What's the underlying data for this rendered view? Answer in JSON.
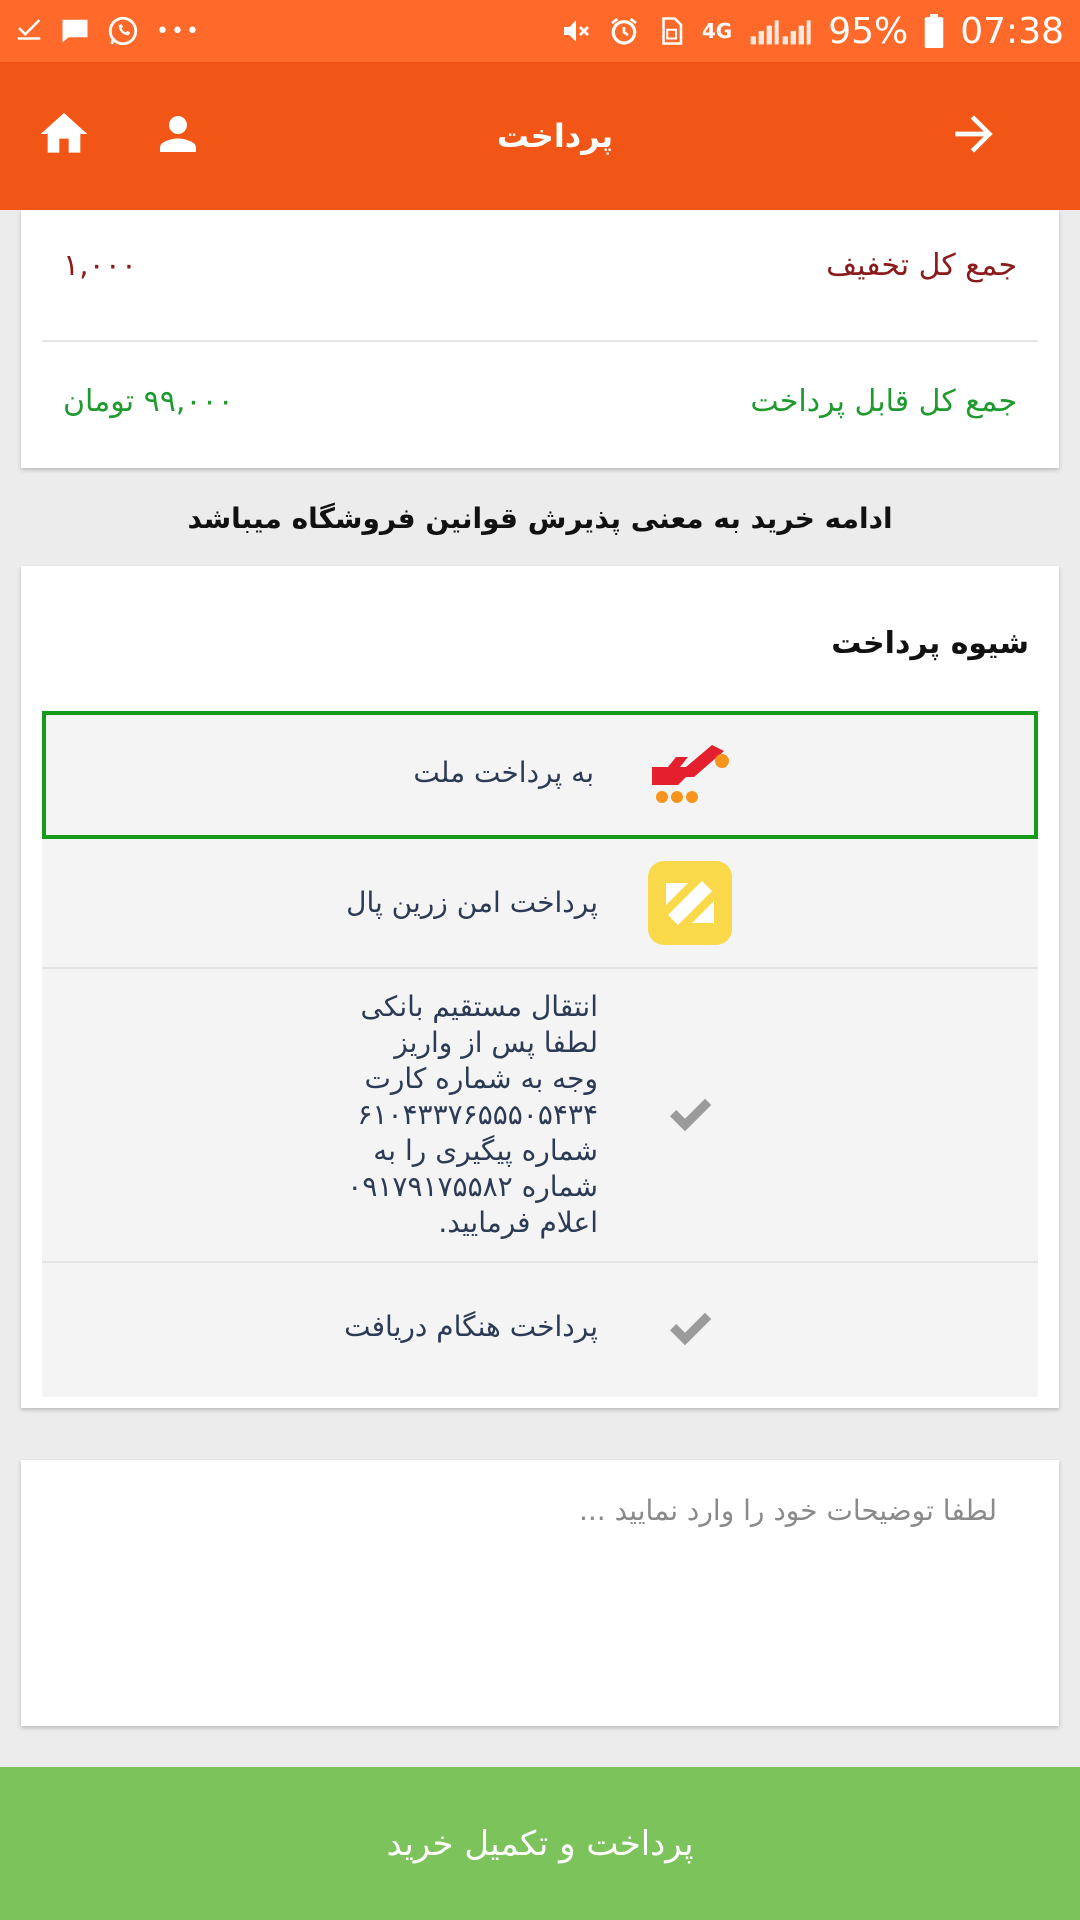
{
  "status_bar": {
    "battery": "95%",
    "time": "07:38",
    "network": "4G",
    "more": "•••",
    "icons": [
      "download-done-icon",
      "message-icon",
      "whatsapp-icon",
      "more-icon",
      "mute-icon",
      "alarm-icon",
      "sim-icon",
      "network-icon",
      "signal-icon",
      "battery-icon"
    ]
  },
  "app_bar": {
    "title": "پرداخت",
    "icons": [
      "home-icon",
      "account-icon",
      "arrow-forward-icon"
    ]
  },
  "totals": {
    "discount_label": "جمع کل تخفیف",
    "discount_value": "۱,۰۰۰",
    "payable_label": "جمع کل قابل پرداخت",
    "payable_value": "۹۹,۰۰۰ تومان"
  },
  "notice": "ادامه خرید به معنی پذیرش قوانین فروشگاه میباشد",
  "payment": {
    "title": "شیوه پرداخت",
    "methods": [
      {
        "label": "به پرداخت ملت",
        "icon": "mellat-logo-icon",
        "selected": true
      },
      {
        "label": "پرداخت امن زرین پال",
        "icon": "zarinpal-logo-icon",
        "selected": false
      },
      {
        "lines": [
          "انتقال مستقیم بانکی",
          "لطفا پس از واریز",
          "وجه به شماره کارت",
          "۶۱۰۴۳۳۷۶۵۵۵۰۵۴۳۴",
          "شماره پیگیری را به",
          "شماره ۰۹۱۷۹۱۷۵۵۸۲",
          "اعلام فرمایید."
        ],
        "icon": "check-icon",
        "selected": false
      },
      {
        "label": "پرداخت هنگام دریافت",
        "icon": "check-icon",
        "selected": false
      }
    ]
  },
  "comment": {
    "placeholder": "لطفا توضیحات خود را وارد نمایید ...",
    "value": ""
  },
  "submit_label": "پرداخت و تکمیل خرید",
  "colors": {
    "status_bar": "#ff6a2b",
    "app_bar": "#f25616",
    "discount_text": "#8b1a1a",
    "payable_text": "#1f9a2e",
    "selected_border": "#159a1a",
    "submit": "#7dc35b"
  }
}
